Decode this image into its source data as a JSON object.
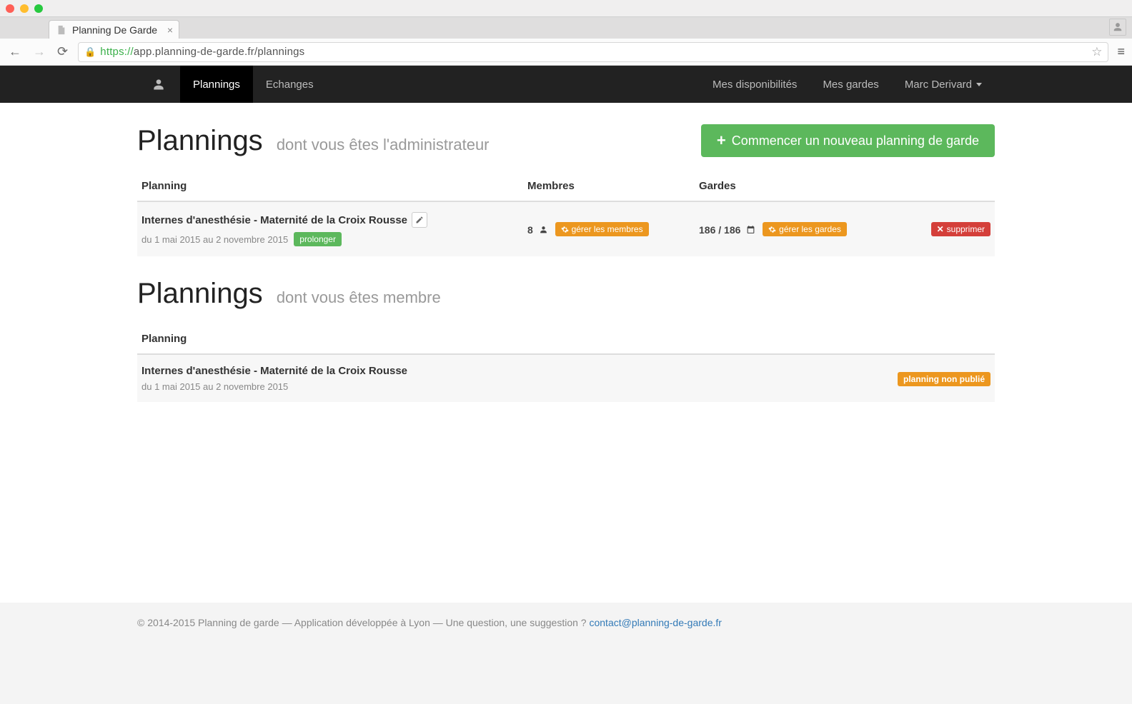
{
  "browser": {
    "tab_title": "Planning De Garde",
    "url_proto": "https://",
    "url_host_path": "app.planning-de-garde.fr/plannings"
  },
  "nav": {
    "plannings": "Plannings",
    "echanges": "Echanges",
    "disponibilites": "Mes disponibilités",
    "gardes": "Mes gardes",
    "user": "Marc Derivard"
  },
  "admin_section": {
    "title": "Plannings",
    "subtitle": "dont vous êtes l'administrateur",
    "new_button": "Commencer un nouveau planning de garde",
    "headers": {
      "planning": "Planning",
      "membres": "Membres",
      "gardes": "Gardes"
    },
    "row": {
      "name": "Internes d'anesthésie - Maternité de la Croix Rousse",
      "dates": "du 1 mai 2015 au 2 novembre 2015",
      "prolonger": "prolonger",
      "members_count": "8",
      "gerer_membres": "gérer les membres",
      "gardes_count": "186 / 186",
      "gerer_gardes": "gérer les gardes",
      "supprimer": "supprimer"
    }
  },
  "member_section": {
    "title": "Plannings",
    "subtitle": "dont vous êtes membre",
    "headers": {
      "planning": "Planning"
    },
    "row": {
      "name": "Internes d'anesthésie - Maternité de la Croix Rousse",
      "dates": "du 1 mai 2015 au 2 novembre 2015",
      "label": "planning non publié"
    }
  },
  "footer": {
    "text": "© 2014-2015 Planning de garde — Application développée à Lyon — Une question, une suggestion ? ",
    "email": "contact@planning-de-garde.fr"
  }
}
